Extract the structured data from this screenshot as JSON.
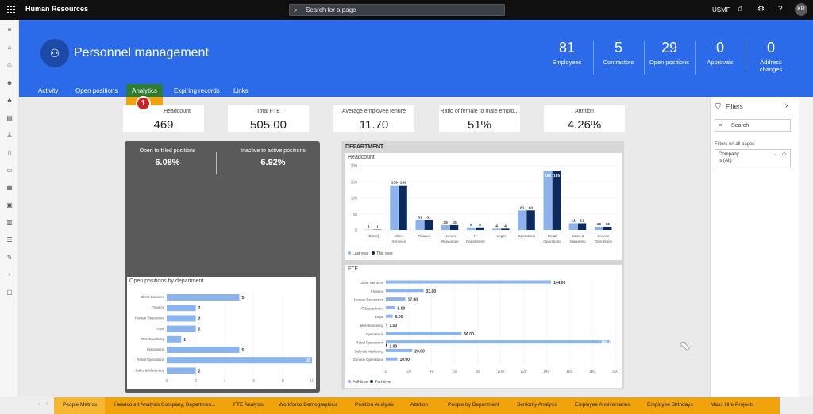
{
  "topbar": {
    "app_title": "Human Resources",
    "search_placeholder": "Search for a page",
    "company": "USMF",
    "avatar": "KR"
  },
  "workspace": {
    "title": "Personnel management"
  },
  "kpis": [
    {
      "value": "81",
      "label": "Employees"
    },
    {
      "value": "5",
      "label": "Contractors"
    },
    {
      "value": "29",
      "label": "Open positions"
    },
    {
      "value": "0",
      "label": "Approvals"
    },
    {
      "value": "0",
      "label": "Address changes"
    }
  ],
  "tabs": [
    "Activity",
    "Open positions",
    "Analytics",
    "Expiring records",
    "Links"
  ],
  "marker": "1",
  "cards": [
    {
      "label": "Headcount",
      "value": "469"
    },
    {
      "label": "Total FTE",
      "value": "505.00"
    },
    {
      "label": "Average employee tenure",
      "value": "11.70"
    },
    {
      "label": "Ratio of female to male emplo...",
      "value": "51%"
    },
    {
      "label": "Attrition",
      "value": "4.26%"
    }
  ],
  "dark": [
    {
      "label": "Open to filled positions",
      "value": "6.08%"
    },
    {
      "label": "Inactive to active positions",
      "value": "6.92%"
    }
  ],
  "filters": {
    "title": "Filters",
    "search": "Search",
    "section": "Filters on all pages",
    "card_title": "Company",
    "card_value": "is (All)"
  },
  "page_tabs": [
    "People Metrics",
    "Headcount Analysis Company, Departmen...",
    "FTE Analysis",
    "Workforce Demographics",
    "Position Analysis",
    "Attrition",
    "People by Department",
    "Seniority Analysis",
    "Employee Anniversaries",
    "Employee Birthdays",
    "Mass Hire Projects"
  ],
  "chart_data": [
    {
      "type": "bar",
      "orientation": "horizontal",
      "title": "Open positions by department",
      "categories": [
        "Client Services",
        "Finance",
        "Human Resources",
        "Legal",
        "Merchandising",
        "Operations",
        "Retail Operations",
        "Sales & Marketing"
      ],
      "values": [
        5,
        2,
        2,
        2,
        1,
        5,
        10,
        2
      ],
      "xlim": [
        0,
        10
      ],
      "xticks": [
        0,
        2,
        4,
        6,
        8,
        10
      ],
      "color": "#8bb4ef"
    },
    {
      "type": "bar",
      "title": "Headcount",
      "section": "DEPARTMENT",
      "categories": [
        "[Blank]",
        "Client Services",
        "Finance",
        "Human Resources",
        "IT Department",
        "Legal",
        "Operations",
        "Retail Operations",
        "Sales & Marketing",
        "Service Operations"
      ],
      "series": [
        {
          "name": "Last year",
          "color": "#8bb4ef",
          "values": [
            1,
            139,
            31,
            15,
            8,
            4,
            61,
            185,
            21,
            10
          ]
        },
        {
          "name": "This year",
          "color": "#0b2a5e",
          "values": [
            1,
            139,
            31,
            15,
            8,
            4,
            61,
            185,
            21,
            10
          ]
        }
      ],
      "ylim": [
        0,
        200
      ],
      "yticks": [
        0,
        50,
        100,
        150,
        200
      ]
    },
    {
      "type": "bar",
      "orientation": "horizontal",
      "title": "FTE",
      "categories": [
        "Client Services",
        "Finance",
        "Human Resources",
        "IT Department",
        "Legal",
        "Merchandising",
        "Operations",
        "Retail Operations",
        "Sales & Marketing",
        "Service Operations"
      ],
      "series": [
        {
          "name": "Full-time",
          "color": "#8bb4ef",
          "values": [
            144,
            33,
            17,
            8,
            6,
            1,
            66,
            196,
            23,
            10
          ]
        },
        {
          "name": "Part-time",
          "color": "#0b2a5e",
          "values": [
            0,
            0,
            0,
            0,
            0,
            0,
            0,
            1,
            0,
            0
          ]
        }
      ],
      "value_labels": [
        "144.00",
        "33.00",
        "17.00",
        "8.00",
        "6.00",
        "1.00",
        "66.00",
        "196.00",
        "1.00",
        "23.00",
        "10.00"
      ],
      "xlim": [
        0,
        200
      ],
      "xticks": [
        0,
        20,
        40,
        60,
        80,
        100,
        120,
        140,
        160,
        180,
        200
      ]
    }
  ]
}
